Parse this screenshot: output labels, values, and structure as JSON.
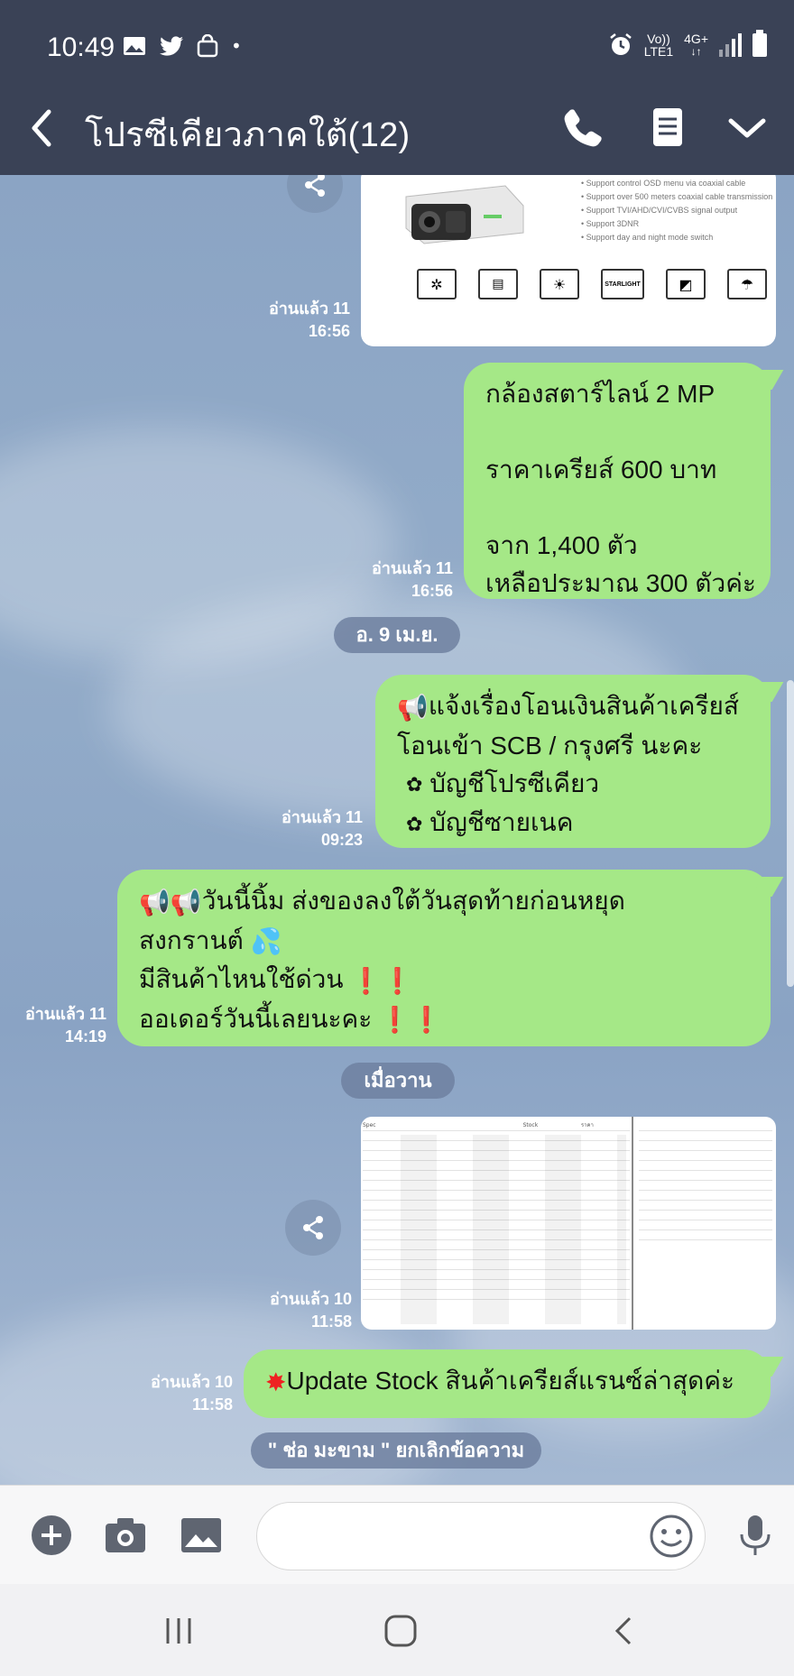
{
  "status_bar": {
    "time": "10:49",
    "net_top": "Vo))",
    "net_bottom": "LTE1",
    "net_type": "4G+",
    "icons": [
      "gallery-icon",
      "twitter-icon",
      "bag-icon",
      "alarm-icon",
      "signal-icon",
      "battery-icon"
    ]
  },
  "header": {
    "title": "โปรซีเคียวภาคใต้(12)",
    "icons": [
      "back-arrow-icon",
      "phone-icon",
      "note-icon",
      "chevron-down-icon"
    ]
  },
  "messages": [
    {
      "type": "image",
      "read": "อ่านแล้ว 11",
      "time": "16:56",
      "spec_lines": [
        "• Support control OSD menu via coaxial cable",
        "• Support over 500 meters coaxial cable transmission",
        "• Support TVI/AHD/CVI/CVBS signal output",
        "• Support 3DNR",
        "• Support day and night mode switch"
      ],
      "badge_label": "STARLIGHT"
    },
    {
      "type": "text",
      "read": "อ่านแล้ว 11",
      "time": "16:56",
      "lines": [
        "กล้องสตาร์ไลน์ 2 MP",
        "",
        "ราคาเครียส์ 600 บาท",
        "",
        "จาก 1,400 ตัว",
        "เหลือประมาณ 300 ตัวค่ะ"
      ]
    },
    {
      "type": "text",
      "read": "อ่านแล้ว 11",
      "time": "09:23",
      "lines": [
        "แจ้งเรื่องโอนเงินสินค้าเครียส์",
        "โอนเข้า SCB / กรุงศรี นะคะ",
        "บัญชีโปรซีเคียว",
        "บัญชีซายเนค"
      ]
    },
    {
      "type": "text",
      "read": "อ่านแล้ว 11",
      "time": "14:19",
      "lines": [
        "วันนี้นิ้ม ส่งของลงใต้วันสุดท้ายก่อนหยุด",
        "สงกรานต์",
        "มีสินค้าไหนใช้ด่วน",
        "ออเดอร์วันนี้เลยนะคะ"
      ]
    },
    {
      "type": "image",
      "read": "อ่านแล้ว 10",
      "time": "11:58",
      "table_headers": [
        "Spec",
        "Stock",
        "ราคา"
      ]
    },
    {
      "type": "text",
      "read": "อ่านแล้ว 10",
      "time": "11:58",
      "lines": [
        "Update Stock สินค้าเครียส์แรนซ์ล่าสุดค่ะ"
      ]
    }
  ],
  "date_separators": [
    "อ. 9 เม.ย.",
    "เมื่อวาน"
  ],
  "system_notice": "\" ช่อ มะขาม \" ยกเลิกข้อความ",
  "input_bar": {
    "placeholder": "",
    "icons": [
      "plus-icon",
      "camera-icon",
      "image-icon",
      "emoji-icon",
      "microphone-icon"
    ]
  },
  "nav_bar": {
    "icons": [
      "recent-apps-icon",
      "home-icon",
      "back-icon"
    ]
  },
  "colors": {
    "header_bg": "#3a4256",
    "bubble_green": "#a5e887",
    "chat_bg": "#8ba4c4"
  }
}
